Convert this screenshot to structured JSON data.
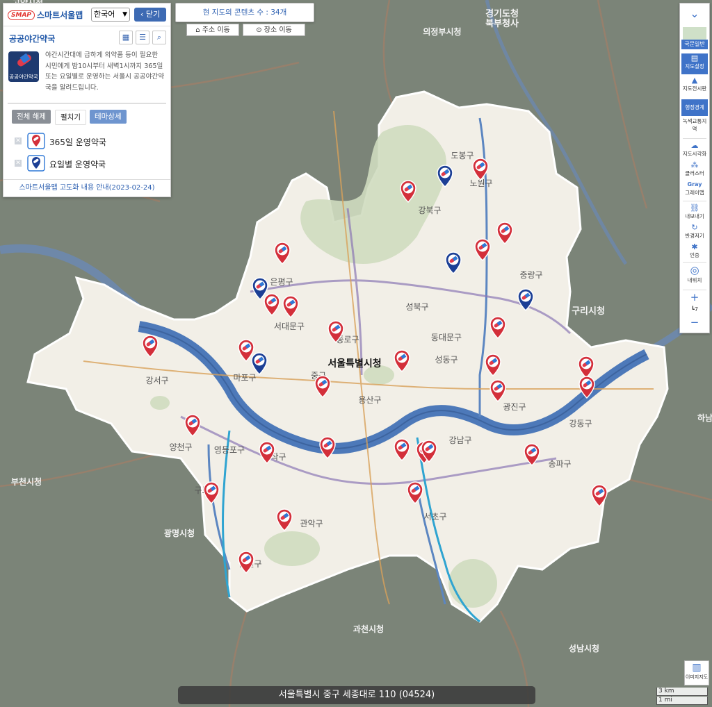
{
  "app": {
    "logo_text": "SMAP",
    "name": "스마트서울맵",
    "language": "한국어",
    "close_label": "닫기",
    "theme_title": "공공야간약국",
    "theme_icon_caption": "공공야간약국",
    "description": "야간시간대에 급하게 의약품 등이 필요한 시민에게 밤10시부터 새벽1시까지 365일 또는 요일별로 운영하는 서울시 공공야간약국을 알려드립니다.",
    "buttons": {
      "clear_all": "전체 해제",
      "expand": "펼치기",
      "theme_detail": "테마상세"
    },
    "legend": [
      {
        "label": "365일 운영약국",
        "color": "#d32f3a"
      },
      {
        "label": "요일별 운영약국",
        "color": "#1c3f95"
      }
    ],
    "notice": "스마트서울맵 고도화 내용 안내(2023-02-24)"
  },
  "map_header": {
    "count_text": "현 지도의 콘텐츠 수 : 34개",
    "address_move": "주소 이동",
    "place_move": "장소 이동"
  },
  "right_toolbar": {
    "basemap": "국문일반",
    "map_settings": "지도설정",
    "map_view": "지도전시판",
    "admin_boundary": "행정경계",
    "green_traffic": "녹색교통지역",
    "visualize": "지도시각화",
    "cluster": "클러스터",
    "gray_title": "Gray",
    "gray_map": "그레이맵",
    "export": "내보내기",
    "rotate": "반경저기",
    "login": "인증",
    "my_location": "내위치",
    "zoom_level": "7",
    "image_map": "이미지지도"
  },
  "scale": {
    "km": "3 km",
    "mi": "1 mi"
  },
  "address_bar": "서울특별시 중구 세종대로 110 (04524)",
  "map": {
    "colors": {
      "seoul_fill": "#f1eee6",
      "outside": "#7a8377",
      "river": "#4a77b6",
      "red_pin": "#d32f3a",
      "blue_pin": "#1c3f95"
    },
    "city_labels": [
      {
        "text": "서울특별시청"
      },
      {
        "text": "경기도청"
      },
      {
        "text": "북부청사"
      },
      {
        "text": "의정부시청"
      },
      {
        "text": "구리시청"
      },
      {
        "text": "부천시청"
      },
      {
        "text": "광명시청"
      },
      {
        "text": "과천시청"
      },
      {
        "text": "성남시청"
      },
      {
        "text": "하남"
      },
      {
        "text": "고양시청"
      }
    ],
    "district_labels": [
      "도봉구",
      "노원구",
      "강북구",
      "은평구",
      "성북구",
      "중랑구",
      "서대문구",
      "종로구",
      "동대문구",
      "강서구",
      "마포구",
      "중구",
      "성동구",
      "광진구",
      "용산구",
      "양천구",
      "영등포구",
      "동작구",
      "강남구",
      "송파구",
      "강동구",
      "구로구",
      "관악구",
      "서초구",
      "금천구"
    ],
    "pins": [
      {
        "type": "red"
      },
      {
        "type": "blue"
      },
      {
        "type": "red"
      },
      {
        "type": "red"
      },
      {
        "type": "red"
      },
      {
        "type": "blue"
      },
      {
        "type": "red"
      },
      {
        "type": "blue"
      },
      {
        "type": "blue"
      },
      {
        "type": "red"
      },
      {
        "type": "red"
      },
      {
        "type": "red"
      },
      {
        "type": "red"
      },
      {
        "type": "red"
      },
      {
        "type": "red"
      },
      {
        "type": "blue"
      },
      {
        "type": "red"
      },
      {
        "type": "red"
      },
      {
        "type": "red"
      },
      {
        "type": "red"
      },
      {
        "type": "red"
      },
      {
        "type": "red"
      },
      {
        "type": "red"
      },
      {
        "type": "red"
      },
      {
        "type": "red"
      },
      {
        "type": "red"
      },
      {
        "type": "red"
      },
      {
        "type": "red"
      },
      {
        "type": "red"
      },
      {
        "type": "red"
      },
      {
        "type": "red"
      },
      {
        "type": "red"
      },
      {
        "type": "red"
      },
      {
        "type": "red"
      }
    ]
  }
}
